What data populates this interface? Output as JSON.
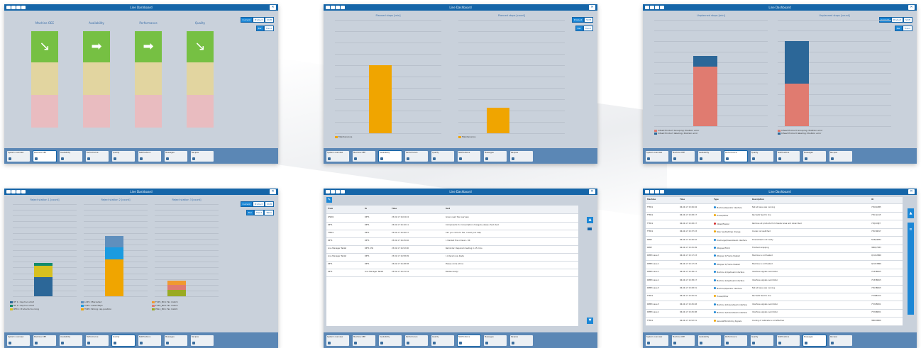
{
  "window_title": "Line Dashboard",
  "close_icon": "close-icon",
  "bottom_nav": [
    {
      "label": "System overview",
      "sub": ""
    },
    {
      "label": "Machine OEE",
      "sub": "OEE"
    },
    {
      "label": "Availability",
      "sub": "OEE"
    },
    {
      "label": "Performance",
      "sub": "OEE"
    },
    {
      "label": "Quality",
      "sub": "OEE"
    },
    {
      "label": "Notifications",
      "sub": "OEE"
    },
    {
      "label": "Messages",
      "sub": "OEE"
    },
    {
      "label": "Recipes",
      "sub": "OEE"
    }
  ],
  "screen1": {
    "toggle1": [
      "Current",
      "Product",
      "Shift"
    ],
    "toggle2": [
      "Bar",
      "Trend"
    ],
    "kpis": [
      {
        "label": "Machine OEE",
        "arrow": "↘"
      },
      {
        "label": "Availability",
        "arrow": "➡"
      },
      {
        "label": "Performance",
        "arrow": "➡"
      },
      {
        "label": "Quality",
        "arrow": "↘"
      }
    ]
  },
  "screen2": {
    "toggle1": [
      "Product",
      "Shift"
    ],
    "toggle2": [
      "Bar",
      "Trend"
    ],
    "chart_data": [
      {
        "type": "bar",
        "title": "Planned stops [min]",
        "categories": [
          "Maintenance"
        ],
        "values": [
          1.2
        ],
        "ylim": [
          0,
          2
        ],
        "legend": [
          "Maintenance"
        ],
        "color": "#f0a500"
      },
      {
        "type": "bar",
        "title": "Planned stops [count]",
        "categories": [
          "Maintenance"
        ],
        "values": [
          0.45
        ],
        "ylim": [
          0,
          2
        ],
        "legend": [
          "Maintenance"
        ],
        "color": "#f0a500"
      }
    ]
  },
  "screen3": {
    "toggle1": [
      "Current",
      "Product",
      "Shift"
    ],
    "toggle2": [
      "Bar",
      "Trend"
    ],
    "chart_data": [
      {
        "type": "bar",
        "title": "Unplanned stops [min]",
        "stack": [
          {
            "name": "Infeed Product Grouping: Position error",
            "value": 0.56,
            "color": "#e07b70"
          },
          {
            "name": "Infeed Product labeling: Position error",
            "value": 0.1,
            "color": "#2c6798"
          }
        ],
        "ylim": [
          0,
          1
        ]
      },
      {
        "type": "bar",
        "title": "Unplanned stops [count]",
        "stack": [
          {
            "name": "Infeed Product Grouping: Position error",
            "value": 0.4,
            "color": "#e07b70"
          },
          {
            "name": "Infeed Product labeling: Position error",
            "value": 0.4,
            "color": "#2c6798"
          }
        ],
        "ylim": [
          0,
          1
        ]
      }
    ],
    "legend": [
      "Infeed Product Grouping: Position error",
      "Infeed Product labeling: Position error"
    ]
  },
  "screen4": {
    "toggle1": [
      "Current",
      "Product",
      "Shift"
    ],
    "toggle2": [
      "Bar",
      "Trend",
      "Table"
    ],
    "titles": [
      "Reject station 1 [count]",
      "Reject station 2 [count]",
      "Reject station 3 [count]"
    ],
    "legend": [
      "RF 1: Cap too short",
      "RF 2: Cap too short",
      "RFC1: Products too long",
      "LCP1: Misrouted",
      "TCP1: Label flaps",
      "TCP2: Wrong cap position",
      "FCP1_BC1: No match",
      "FCP1_BC2: No match",
      "PKL1_BC1: No match"
    ]
  },
  "screen5": {
    "columns": [
      "From",
      "To",
      "Time",
      "Text"
    ],
    "rows": [
      {
        "from": "WW02",
        "to": "RPT1",
        "time": "23.02.17 16:04:24",
        "text": "Ginen need the overview"
      },
      {
        "from": "RPT1",
        "to": "RPT1",
        "time": "23.02.17 16:10:11",
        "text": "Components for consumption changed, please check bed"
      },
      {
        "from": "TTBC1",
        "to": "RPT1",
        "time": "23.02.17 16:40:57",
        "text": "Can you come to the, I need your help"
      },
      {
        "from": "RPT1",
        "to": "RPT1",
        "time": "23.02.17 16:45:46",
        "text": "I checked the oil level - OK"
      },
      {
        "from": "Line Manager Tablet",
        "to": "RPT1 OW",
        "time": "23.02.17 16:52:00",
        "text": "Reminder: Required meeting in 15 mins"
      },
      {
        "from": "Line Manager Tablet",
        "to": "RPT1",
        "time": "23.02.17 16:58:09",
        "text": "I ordered new blade"
      },
      {
        "from": "RPT1",
        "to": "RPT1",
        "time": "23.02.17 16:48:38",
        "text": "Please come at line"
      },
      {
        "from": "RPT1",
        "to": "Line Manager Tablet",
        "time": "23.02.17 16:41:34",
        "text": "Blades ready!"
      }
    ]
  },
  "screen6": {
    "columns": [
      "Machine",
      "Time",
      "Type",
      "Description",
      "ID"
    ],
    "rows": [
      {
        "machine": "TTBC1",
        "time": "06.04.17 15:26:04",
        "type": "Machine/Operator interface",
        "desc": "Not all lanes are running",
        "id": "73U0A5B5"
      },
      {
        "machine": "TTBC1",
        "time": "06.04.17 15:28:17",
        "type": "Fluxes/Other",
        "desc": "Rechedk feed to line",
        "id": "73U12A15"
      },
      {
        "machine": "TTBC1",
        "time": "06.04.17 15:28:17",
        "type": "Infeed/Feeder",
        "desc": "Remove all products from feeder area and reload bed",
        "id": "73Q2UBJ7"
      },
      {
        "machine": "TTBC1",
        "time": "06.04.17 15:37:23",
        "type": "Stop handled/Cap change",
        "desc": "Cooler out switched",
        "id": "73U34B17"
      },
      {
        "machine": "RPRE",
        "time": "06.04.17 15:40:52",
        "type": "Discharge/Downstream interface",
        "desc": "Downstream not ready",
        "id": "5D3Q9B31"
      },
      {
        "machine": "RPRE",
        "time": "06.04.17 15:25:09",
        "type": "Wrapper/Filmd",
        "desc": "Finished wrapping",
        "id": "3B0Q7B33"
      },
      {
        "machine": "RMB3 Lane 3",
        "time": "06.04.17 15:17:23",
        "type": "Wrapper 1/Frame Heated",
        "desc": "Machine is not heated",
        "id": "Q2U12B00"
      },
      {
        "machine": "RMB3 Lane 1",
        "time": "06.04.17 15:17:23",
        "type": "Wrapper 1/Frame Heated",
        "desc": "Machine is not heated",
        "id": "Q2U13B00"
      },
      {
        "machine": "RMB3 Lane 1",
        "time": "06.04.17 15:38:17",
        "type": "Machine 1/Upstream Interface",
        "desc": "Interface signals overridden",
        "id": "7U33B0U5"
      },
      {
        "machine": "RMB3 Lane 1",
        "time": "06.04.17 15:38:17",
        "type": "Machine 1/Upstream Interface",
        "desc": "Interface signals overridden",
        "id": "7U33B0U5"
      },
      {
        "machine": "RMB3 Lane 3",
        "time": "06.04.17 15:28:31",
        "type": "Machine/Operator interface",
        "desc": "Not all lanes are running",
        "id": "73U3B0U5"
      },
      {
        "machine": "TTBC1",
        "time": "06.04.17 15:20:01",
        "type": "Fluxes/Other",
        "desc": "Rechedk feed to line",
        "id": "7T22B0U3"
      },
      {
        "machine": "RMB3 Lane 3",
        "time": "06.04.17 15:45:48",
        "type": "Machine 1/Downstream Interface",
        "desc": "Interface signals overridden",
        "id": "7T2U5B01"
      },
      {
        "machine": "RMB3 Lane 1",
        "time": "06.04.17 15:45:08",
        "type": "Machine 1/Downstream Interface",
        "desc": "Interface signals overridden",
        "id": "7T2U6B01"
      },
      {
        "machine": "TTBC1",
        "time": "06.04.17 15:52:51",
        "type": "General/Monitoring Signals",
        "desc": "Cooling of cabinets is not effective",
        "id": "3B0U9B00"
      }
    ]
  },
  "colors": {
    "titlebar": "#1565a8",
    "bottombar": "#5b87b5",
    "panel": "#c9d1db",
    "accent": "#1b87d6",
    "green": "#76c043",
    "yellow": "#e2d5a0",
    "red": "#e9bcc0",
    "orange": "#f0a500"
  }
}
